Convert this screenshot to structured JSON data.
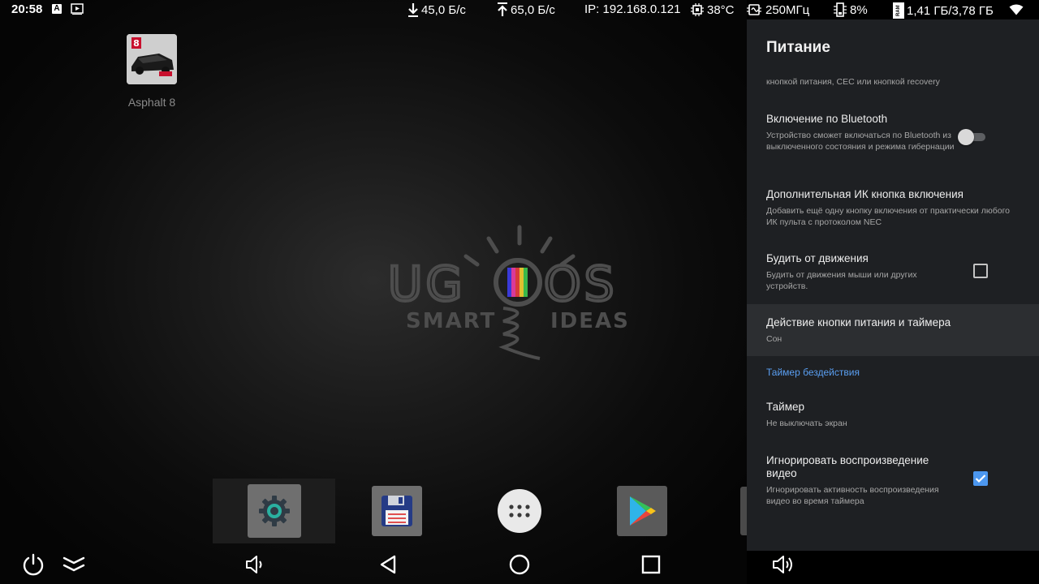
{
  "status_bar": {
    "time": "20:58",
    "download_speed": "45,0 Б/с",
    "upload_speed": "65,0 Б/с",
    "ip": "IP: 192.168.0.121",
    "cpu_temp": "38°C",
    "cpu_freq": "250МГц",
    "cpu_load": "8%",
    "ram_label": "RAM",
    "ram": "1,41 ГБ/3,78 ГБ",
    "icons": [
      "a-icon",
      "cast-icon",
      "download-icon",
      "upload-icon",
      "chip-icon",
      "cpu-freq-icon",
      "cpu-load-icon",
      "ram-icon",
      "wifi-icon"
    ]
  },
  "desktop": {
    "apps": [
      {
        "label": "Asphalt 8",
        "badge": "8"
      }
    ],
    "logo": {
      "line1_left": "UG",
      "line1_right": "OS",
      "line2_left": "SMART",
      "line2_right": "IDEAS"
    },
    "dock": [
      {
        "name": "settings",
        "icon": "gear-icon",
        "selected": true
      },
      {
        "name": "file-manager",
        "icon": "floppy-icon",
        "selected": false
      },
      {
        "name": "all-apps",
        "icon": "apps-grid-icon",
        "selected": false
      },
      {
        "name": "play-store",
        "icon": "play-store-icon",
        "selected": false
      }
    ]
  },
  "nav_bar": {
    "buttons": [
      "power-icon",
      "collapse-icon",
      "volume-down-icon",
      "back-icon",
      "home-icon",
      "recents-icon",
      "volume-up-icon"
    ]
  },
  "settings_panel": {
    "title": "Питание",
    "cut_off_summary": "кнопкой питания, CEC или кнопкой recovery",
    "items": [
      {
        "title": "Включение по Bluetooth",
        "summary": "Устройство сможет включаться по Bluetooth из выключенного состояния и режима гибернации",
        "control": "toggle",
        "checked": false
      },
      {
        "title": "Дополнительная ИК кнопка включения",
        "summary": "Добавить ещё одну кнопку включения от практически любого ИК пульта с протоколом NEC",
        "control": "none"
      },
      {
        "title": "Будить от движения",
        "summary": "Будить от движения мыши или других устройств.",
        "control": "checkbox",
        "checked": false
      },
      {
        "title": "Действие кнопки питания и таймера",
        "summary": "Сон",
        "control": "none",
        "focused": true
      }
    ],
    "section_header": "Таймер бездействия",
    "timer_items": [
      {
        "title": "Таймер",
        "summary": "Не выключать экран",
        "control": "none"
      },
      {
        "title": "Игнорировать воспроизведение видео",
        "summary": "Игнорировать активность воспроизведения видео во время таймера",
        "control": "checkbox",
        "checked": true
      }
    ]
  },
  "colors": {
    "panel_bg": "#1e2023",
    "focus_bg": "#2c2e31",
    "accent": "#4c97ef",
    "section_header": "#5a9ff2"
  }
}
